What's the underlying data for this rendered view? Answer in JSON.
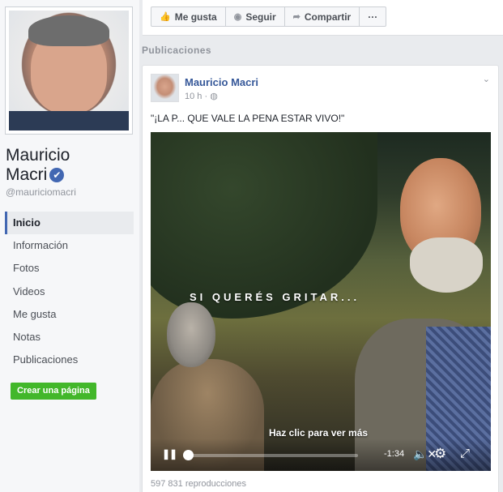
{
  "profile": {
    "name_line1": "Mauricio",
    "name_line2": "Macri",
    "handle": "@mauriciomacri",
    "verified_icon": "✔"
  },
  "nav": {
    "items": [
      {
        "label": "Inicio",
        "active": true
      },
      {
        "label": "Información"
      },
      {
        "label": "Fotos"
      },
      {
        "label": "Videos"
      },
      {
        "label": "Me gusta"
      },
      {
        "label": "Notas"
      },
      {
        "label": "Publicaciones"
      }
    ],
    "create_page": "Crear una página"
  },
  "actions": {
    "like": "Me gusta",
    "follow": "Seguir",
    "share": "Compartir",
    "more": "···",
    "like_icon": "👍",
    "follow_icon": "◉",
    "share_icon": "➦"
  },
  "section": {
    "title": "Publicaciones"
  },
  "post": {
    "author": "Mauricio Macri",
    "time": "10 h ·",
    "privacy_icon": "◍",
    "text": "\"¡LA P... QUE VALE LA PENA ESTAR VIVO!\"",
    "video": {
      "overlay": "SI QUERÉS GRITAR...",
      "cta": "Haz clic para ver más",
      "time_remaining": "-1:34",
      "progress": 0.0
    },
    "views": "597 831 reproducciones"
  },
  "colors": {
    "brand": "#4267b2",
    "link": "#365899",
    "create_button": "#42b72a"
  }
}
